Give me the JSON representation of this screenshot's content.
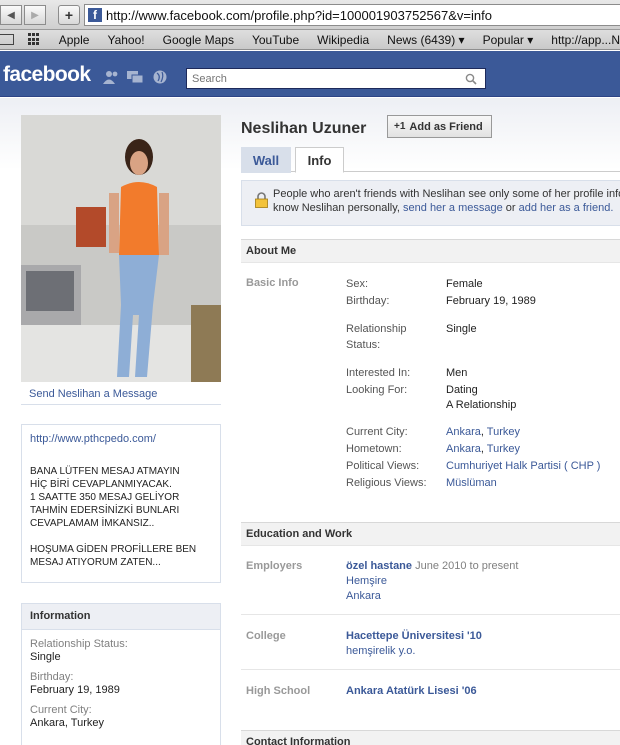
{
  "browser": {
    "back_label": "◀",
    "forward_label": "▶",
    "plus_label": "+",
    "url_icon_letter": "f",
    "url": "http://www.facebook.com/profile.php?id=100001903752567&v=info",
    "bookmarks": [
      "Apple",
      "Yahoo!",
      "Google Maps",
      "YouTube",
      "Wikipedia",
      "News (6439) ▾",
      "Popular ▾",
      "http://app...N"
    ]
  },
  "header": {
    "logo": "facebook",
    "search_placeholder": "Search"
  },
  "sidebar": {
    "send_message": "Send Neslihan a Message",
    "bio_url": "http://www.pthcpedo.com/",
    "bio_text": "BANA LÜTFEN MESAJ ATMAYIN\nHİÇ BİRİ CEVAPLANMIYACAK.\n1 SAATTE 350 MESAJ GELİYOR\nTAHMİN EDERSİNİZKİ BUNLARI\nCEVAPLAMAM İMKANSIZ..\n\nHOŞUMA GİDEN PROFİLLERE BEN\nMESAJ ATIYORUM ZATEN...",
    "info_title": "Information",
    "info": [
      {
        "label": "Relationship Status:",
        "value": "Single"
      },
      {
        "label": "Birthday:",
        "value": "February 19, 1989"
      },
      {
        "label": "Current City:",
        "value": "Ankara, Turkey"
      }
    ]
  },
  "profile": {
    "name": "Neslihan Uzuner",
    "add_friend": "Add as Friend",
    "add_friend_icon": "+1",
    "tabs": {
      "wall": "Wall",
      "info": "Info"
    },
    "privacy": {
      "line1": "People who aren't friends with Neslihan see only some of her profile information. If you",
      "line2_prefix": "know Neslihan personally, ",
      "send_message": "send her a message",
      "or": " or ",
      "add_friend": "add her as a friend."
    }
  },
  "about": {
    "title": "About Me",
    "basic_info_label": "Basic Info",
    "sex_label": "Sex:",
    "sex": "Female",
    "birthday_label": "Birthday:",
    "birthday": "February 19, 1989",
    "relationship_label_1": "Relationship",
    "relationship_label_2": "Status:",
    "relationship": "Single",
    "interested_label": "Interested In:",
    "interested": "Men",
    "looking_label": "Looking For:",
    "looking_1": "Dating",
    "looking_2": "A Relationship",
    "city_label": "Current City:",
    "city_a": "Ankara",
    "city_b": "Turkey",
    "hometown_label": "Hometown:",
    "hometown_a": "Ankara",
    "hometown_b": "Turkey",
    "political_label": "Political Views:",
    "political": "Cumhuriyet Halk Partisi ( CHP )",
    "religious_label": "Religious Views:",
    "religious": "Müslüman"
  },
  "education": {
    "title": "Education and Work",
    "employers_label": "Employers",
    "employer": "özel hastane",
    "employer_dates": "June 2010 to present",
    "employer_position": "Hemşire",
    "employer_city": "Ankara",
    "college_label": "College",
    "college": "Hacettepe Üniversitesi '10",
    "college_concentration": "hemşirelik y.o.",
    "highschool_label": "High School",
    "highschool": "Ankara Atatürk Lisesi '06"
  },
  "contact": {
    "title": "Contact Information"
  },
  "colors": {
    "facebook_blue": "#3b5998",
    "tab_bg": "#d8dfea",
    "notice_bg": "#edeff4"
  }
}
